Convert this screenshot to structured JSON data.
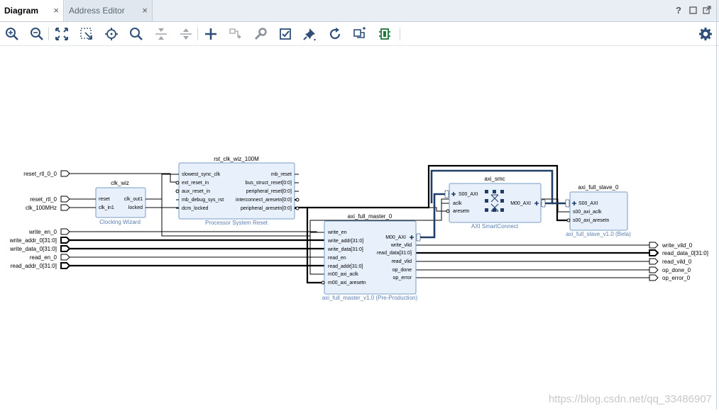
{
  "tabs": {
    "diagram": "Diagram",
    "address_editor": "Address Editor",
    "close_symbol": "×"
  },
  "window_controls": {
    "help": "?"
  },
  "toolbar": {
    "icons": [
      "zoom-in-icon",
      "zoom-out-icon",
      "zoom-fit-icon",
      "zoom-area-icon",
      "center-icon",
      "search-icon",
      "collapse-icon",
      "expand-icon",
      "add-ip-icon",
      "make-connection-icon",
      "properties-wrench-icon",
      "validate-icon",
      "pin-icon",
      "refresh-icon",
      "regenerate-layout-icon",
      "optimize-icon"
    ],
    "settings_icon": "gear-icon"
  },
  "diagram": {
    "ports_left": [
      {
        "id": "reset_rtl_0_0",
        "label": "reset_rtl_0_0"
      },
      {
        "id": "reset_rtl_0",
        "label": "reset_rtl_0"
      },
      {
        "id": "clk_100MHz",
        "label": "clk_100MHz"
      },
      {
        "id": "write_en_0",
        "label": "write_en_0"
      },
      {
        "id": "write_addr_0",
        "label": "write_addr_0[31:0]"
      },
      {
        "id": "write_data_0",
        "label": "write_data_0[31:0]"
      },
      {
        "id": "read_en_0",
        "label": "read_en_0"
      },
      {
        "id": "read_addr_0",
        "label": "read_addr_0[31:0]"
      }
    ],
    "ports_right": [
      {
        "id": "write_vlid_0",
        "label": "write_vild_0"
      },
      {
        "id": "read_data_0",
        "label": "read_data_0[31:0]"
      },
      {
        "id": "read_vlid_0",
        "label": "read_vild_0"
      },
      {
        "id": "op_done_0",
        "label": "op_done_0"
      },
      {
        "id": "op_error_0",
        "label": "op_error_0"
      }
    ],
    "blocks": {
      "clk_wiz": {
        "name": "clk_wiz",
        "subtitle": "Clocking Wizard",
        "in": [
          "reset",
          "clk_in1"
        ],
        "out": [
          "clk_out1",
          "locked"
        ]
      },
      "rst": {
        "name": "rst_clk_wiz_100M",
        "subtitle": "Processor System Reset",
        "in": [
          "slowest_sync_clk",
          "ext_reset_in",
          "aux_reset_in",
          "mb_debug_sys_rst",
          "dcm_locked"
        ],
        "out": [
          "mb_reset",
          "bus_struct_reset[0:0]",
          "peripheral_reset[0:0]",
          "interconnect_aresetn[0:0]",
          "peripheral_aresetn[0:0]"
        ]
      },
      "master": {
        "name": "axi_full_master_0",
        "subtitle": "axi_full_master_v1.0 (Pre-Production)",
        "in": [
          "write_en",
          "write_addr[31:0]",
          "write_data[31:0]",
          "read_en",
          "read_addr[31:0]",
          "m00_axi_aclk",
          "m00_axi_aresetn"
        ],
        "out": [
          "M00_AXI",
          "write_vlid",
          "read_data[31:0]",
          "read_vlid",
          "op_done",
          "op_error"
        ]
      },
      "smc": {
        "name": "axi_smc",
        "subtitle": "AXI SmartConnect",
        "in": [
          "S00_AXI",
          "aclk",
          "aresetn"
        ],
        "out": [
          "M00_AXI"
        ]
      },
      "slave": {
        "name": "axi_full_slave_0",
        "subtitle": "axi_full_slave_v1.0 (Beta)",
        "in": [
          "S00_AXI",
          "s00_axi_aclk",
          "s00_axi_aresetn"
        ]
      }
    }
  },
  "watermark": "https://blog.csdn.net/qq_33486907",
  "colors": {
    "block_fill": "#e8f1fb",
    "block_border": "#7a9cc6",
    "subtitle": "#5a7fb0",
    "wire": "#000000",
    "bus": "#1f3d66"
  }
}
